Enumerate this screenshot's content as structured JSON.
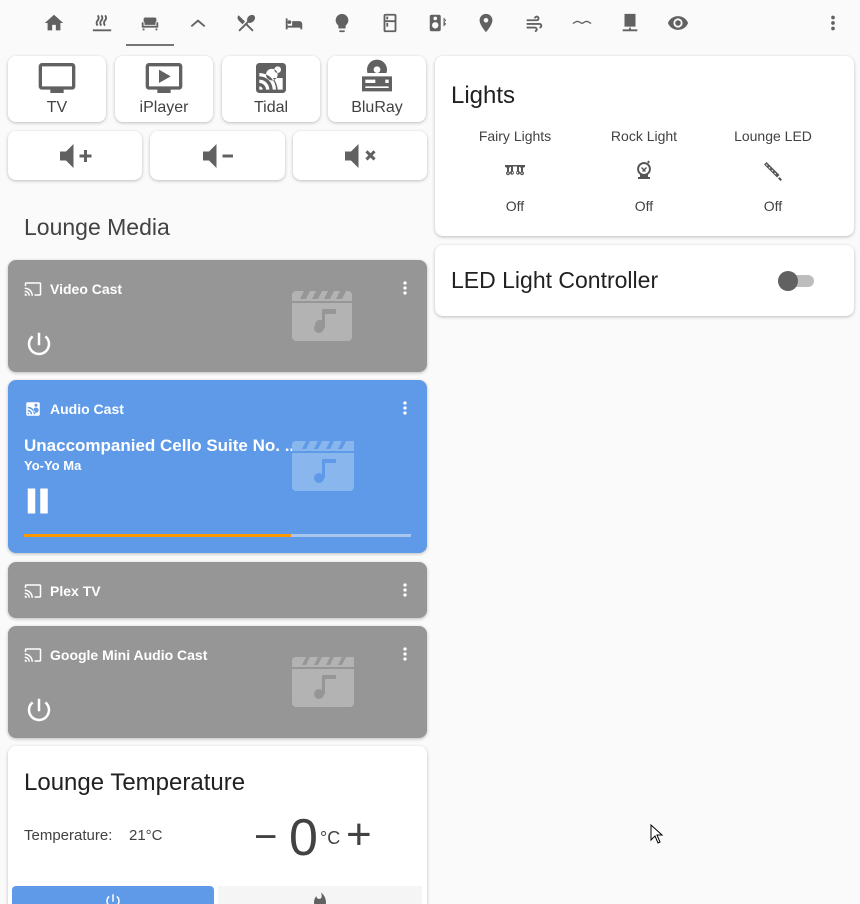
{
  "topbar": {
    "tabs": [
      {
        "icon": "home-icon"
      },
      {
        "icon": "radiator-icon"
      },
      {
        "icon": "sofa-icon",
        "active": true
      },
      {
        "icon": "roof-icon"
      },
      {
        "icon": "silverware-icon"
      },
      {
        "icon": "bed-icon"
      },
      {
        "icon": "lightbulb-icon"
      },
      {
        "icon": "fridge-icon"
      },
      {
        "icon": "speaker-bluetooth-icon"
      },
      {
        "icon": "map-marker-icon"
      },
      {
        "icon": "weather-windy-icon"
      },
      {
        "icon": "wave-icon"
      },
      {
        "icon": "desktop-tower-icon"
      },
      {
        "icon": "eye-icon"
      }
    ]
  },
  "sources": [
    {
      "label": "TV",
      "icon": "television-icon"
    },
    {
      "label": "iPlayer",
      "icon": "play-box-icon"
    },
    {
      "label": "Tidal",
      "icon": "cast-audio-icon"
    },
    {
      "label": "BluRay",
      "icon": "disc-player-icon"
    }
  ],
  "volume": {
    "up": "volume-plus-icon",
    "down": "volume-minus-icon",
    "mute": "volume-mute-icon"
  },
  "lounge_media": {
    "title": "Lounge Media",
    "players": [
      {
        "name": "Video Cast",
        "state": "off"
      },
      {
        "name": "Audio Cast",
        "state": "playing",
        "track": "Unaccompanied Cello Suite No. ...",
        "artist": "Yo-Yo Ma",
        "progress": 0.69
      },
      {
        "name": "Plex TV",
        "state": "idle"
      },
      {
        "name": "Google Mini Audio Cast",
        "state": "off"
      }
    ]
  },
  "lights": {
    "title": "Lights",
    "entities": [
      {
        "name": "Fairy Lights",
        "state": "Off",
        "icon": "string-lights-icon"
      },
      {
        "name": "Rock Light",
        "state": "Off",
        "icon": "lamp-icon"
      },
      {
        "name": "Lounge LED",
        "state": "Off",
        "icon": "led-strip-icon"
      }
    ]
  },
  "led_controller": {
    "title": "LED Light Controller",
    "on": false
  },
  "thermostat": {
    "title": "Lounge Temperature",
    "current_label": "Temperature:",
    "current_value": "21°C",
    "minus": "−",
    "setpoint": "0",
    "unit": "°C",
    "plus": "+",
    "modes": [
      {
        "icon": "power-icon",
        "active": true
      },
      {
        "icon": "fire-icon",
        "active": false
      }
    ]
  },
  "colors": {
    "accent_blue": "#5e9ae8",
    "progress_orange": "#ff9800",
    "inactive_gray": "#969696"
  }
}
